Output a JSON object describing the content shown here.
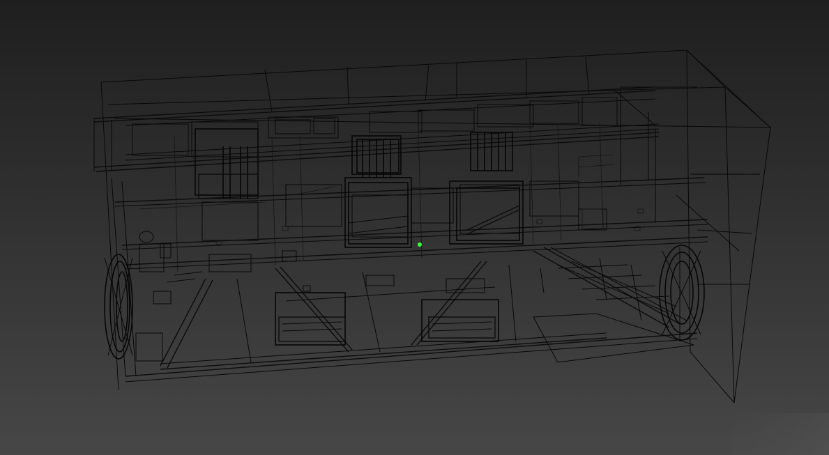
{
  "viewport": {
    "background_top": "#1f1f1f",
    "background_bottom": "#474747",
    "wire_color": "#080808",
    "pivot_color": "#3cff3c",
    "pivot_icon": "pivot-point-icon"
  }
}
